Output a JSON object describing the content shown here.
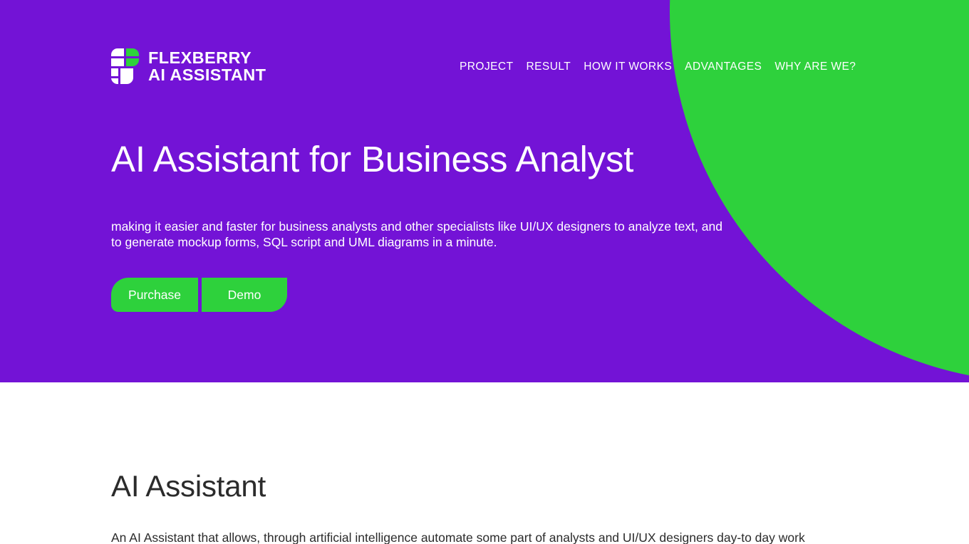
{
  "colors": {
    "purple": "#7313d6",
    "green": "#2ed13c",
    "white": "#ffffff",
    "dark_text": "#2b2b2b"
  },
  "header": {
    "brand": {
      "logo_icon": "flexberry-tiles-logo-icon",
      "line1": "FLEXBERRY",
      "line2": "AI ASSISTANT"
    },
    "nav": [
      {
        "label": "PROJECT"
      },
      {
        "label": "RESULT"
      },
      {
        "label": "HOW IT WORKS"
      },
      {
        "label": "ADVANTAGES"
      },
      {
        "label": "WHY ARE WE?"
      }
    ]
  },
  "hero": {
    "title": "AI Assistant for Business Analyst",
    "subtitle": "making it easier and faster for business analysts and other specialists like UI/UX designers to analyze text, and to generate mockup forms, SQL script and UML diagrams in a minute.",
    "buttons": {
      "purchase": "Purchase",
      "demo": "Demo"
    }
  },
  "section": {
    "title": "AI Assistant",
    "body": "An AI Assistant that allows, through artificial intelligence automate some part of analysts and UI/UX designers day-to day work"
  }
}
